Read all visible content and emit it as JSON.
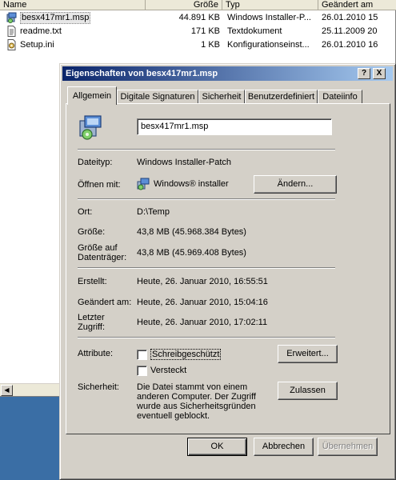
{
  "explorer": {
    "columns": {
      "name": "Name",
      "size": "Größe",
      "type": "Typ",
      "date": "Geändert am"
    },
    "files": [
      {
        "name": "besx417mr1.msp",
        "size": "44.891 KB",
        "type": "Windows Installer-P...",
        "date": "26.01.2010 15",
        "icon": "msi-package-icon"
      },
      {
        "name": "readme.txt",
        "size": "171 KB",
        "type": "Textdokument",
        "date": "25.11.2009 20",
        "icon": "text-document-icon"
      },
      {
        "name": "Setup.ini",
        "size": "1 KB",
        "type": "Konfigurationseinst...",
        "date": "26.01.2010 16",
        "icon": "settings-file-icon"
      }
    ],
    "scroll_left_glyph": "◀"
  },
  "dialog": {
    "title": "Eigenschaften von besx417mr1.msp",
    "help_glyph": "?",
    "close_glyph": "X",
    "tabs": [
      {
        "label": "Allgemein",
        "active": true
      },
      {
        "label": "Digitale Signaturen",
        "active": false
      },
      {
        "label": "Sicherheit",
        "active": false
      },
      {
        "label": "Benutzerdefiniert",
        "active": false
      },
      {
        "label": "Dateiinfo",
        "active": false
      }
    ],
    "general": {
      "filename": "besx417mr1.msp",
      "type_label": "Dateityp:",
      "type_value": "Windows Installer-Patch",
      "opens_label": "Öffnen mit:",
      "opens_value": "Windows® installer",
      "change_button": "Ändern...",
      "location_label": "Ort:",
      "location_value": "D:\\Temp",
      "size_label": "Größe:",
      "size_value": "43,8 MB (45.968.384 Bytes)",
      "size_on_disk_label_1": "Größe auf",
      "size_on_disk_label_2": "Datenträger:",
      "size_on_disk_value": "43,8 MB (45.969.408 Bytes)",
      "created_label": "Erstellt:",
      "created_value": "Heute, 26. Januar 2010, 16:55:51",
      "modified_label": "Geändert am:",
      "modified_value": "Heute, 26. Januar 2010, 15:04:16",
      "accessed_label_1": "Letzter",
      "accessed_label_2": "Zugriff:",
      "accessed_value": "Heute, 26. Januar 2010, 17:02:11",
      "attributes_label": "Attribute:",
      "readonly_label": "Schreibgeschützt",
      "readonly_checked": false,
      "hidden_label": "Versteckt",
      "hidden_checked": false,
      "advanced_button": "Erweitert...",
      "security_label": "Sicherheit:",
      "security_text_1": "Die Datei stammt von einem",
      "security_text_2": "anderen Computer. Der Zugriff",
      "security_text_3": "wurde aus Sicherheitsgründen",
      "security_text_4": "eventuell geblockt.",
      "unblock_button": "Zulassen"
    },
    "footer": {
      "ok": "OK",
      "cancel": "Abbrechen",
      "apply": "Übernehmen"
    }
  }
}
